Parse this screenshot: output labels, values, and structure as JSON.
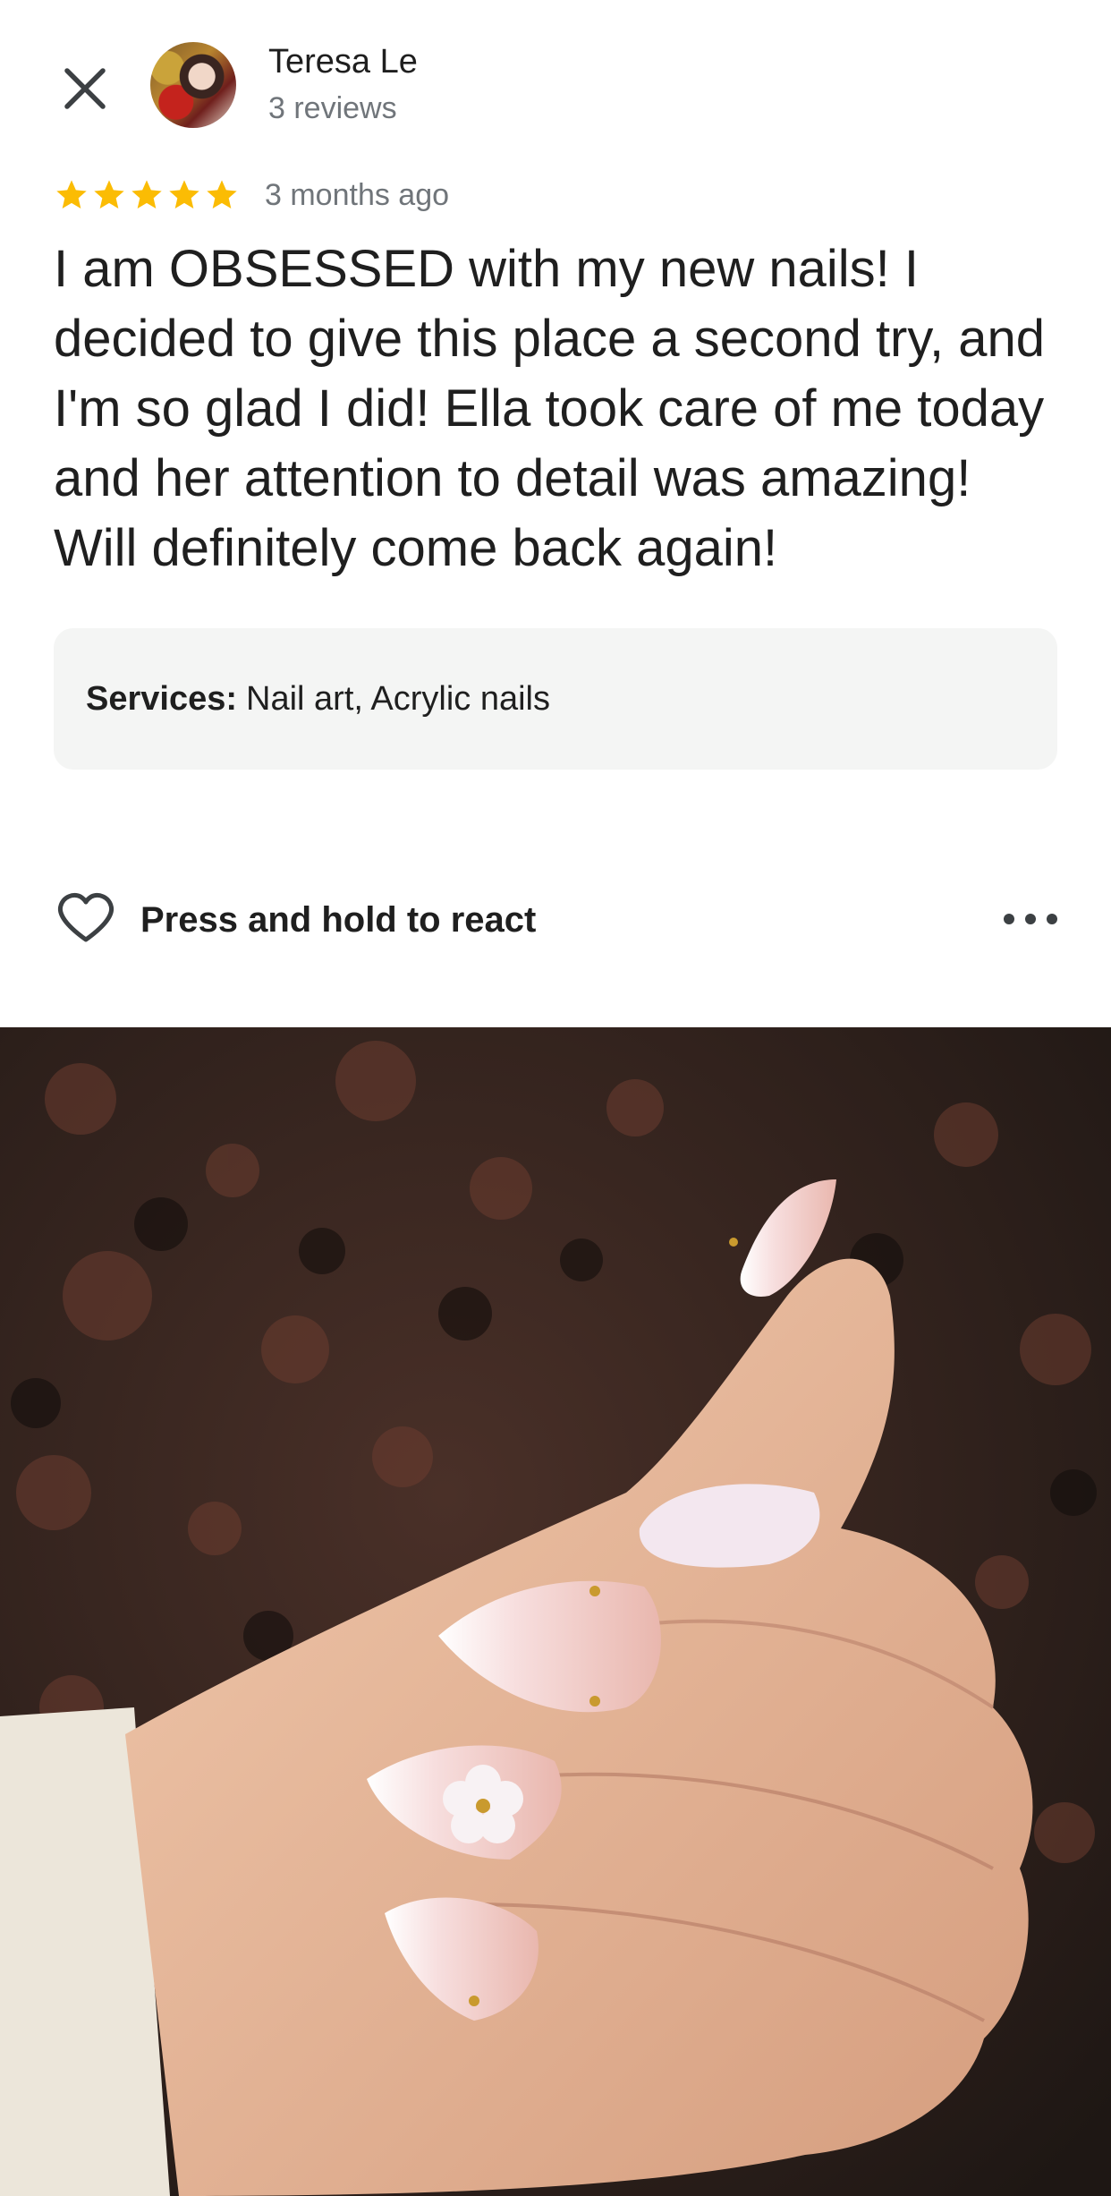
{
  "header": {
    "close_icon": "close-icon",
    "reviewer_name": "Teresa Le",
    "reviewer_meta": "3 reviews"
  },
  "review": {
    "rating": 5,
    "rating_max": 5,
    "star_color": "#fbbc04",
    "time_ago": "3 months ago",
    "text": "I am OBSESSED with my new nails! I decided to give this place a second try, and I'm so glad I did! Ella took care of me today and her attention to detail was amazing! Will definitely come back again!"
  },
  "services": {
    "label": "Services:",
    "value": "Nail art, Acrylic nails"
  },
  "actions": {
    "react_icon": "heart-outline-icon",
    "react_label": "Press and hold to react",
    "more_icon": "more-horizontal-icon"
  },
  "photo": {
    "subject": "hand-with-nail-art-photo"
  }
}
